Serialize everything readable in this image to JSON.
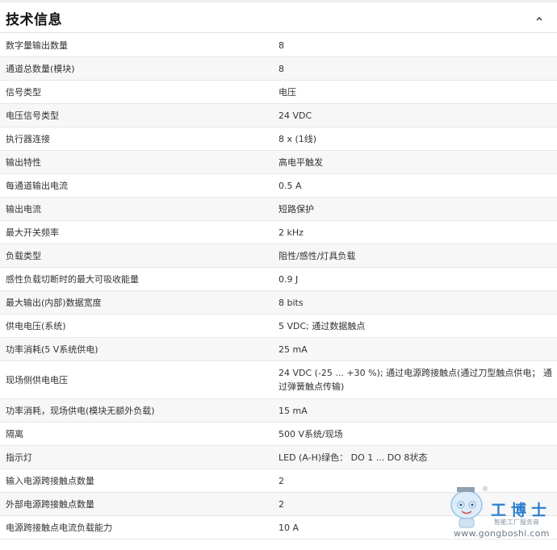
{
  "section": {
    "title": "技术信息"
  },
  "rows": [
    {
      "key": "数字量输出数量",
      "value": "8"
    },
    {
      "key": "通道总数量(模块)",
      "value": "8"
    },
    {
      "key": "信号类型",
      "value": "电压"
    },
    {
      "key": "电压信号类型",
      "value": "24 VDC"
    },
    {
      "key": "执行器连接",
      "value": "8 x (1线)"
    },
    {
      "key": "输出特性",
      "value": "高电平触发"
    },
    {
      "key": "每通道输出电流",
      "value": "0.5 A"
    },
    {
      "key": "输出电流",
      "value": "短路保护"
    },
    {
      "key": "最大开关频率",
      "value": "2 kHz"
    },
    {
      "key": "负载类型",
      "value": "阻性/感性/灯具负载"
    },
    {
      "key": "感性负载切断时的最大可吸收能量",
      "value": "0.9 J"
    },
    {
      "key": "最大输出(内部)数据宽度",
      "value": "8 bits"
    },
    {
      "key": "供电电压(系统)",
      "value": "5 VDC; 通过数据触点"
    },
    {
      "key": "功率消耗(5 V系统供电)",
      "value": "25 mA"
    },
    {
      "key": "现场侧供电电压",
      "value": "24 VDC (-25 ... +30 %); 通过电源跨接触点(通过刀型触点供电； 通过弹簧触点传输)"
    },
    {
      "key": "功率消耗，现场供电(模块无额外负载)",
      "value": "15 mA"
    },
    {
      "key": "隔离",
      "value": "500 V系统/现场"
    },
    {
      "key": "指示灯",
      "value": "LED (A-H)绿色： DO 1 ... DO 8状态"
    },
    {
      "key": "输入电源跨接触点数量",
      "value": "2"
    },
    {
      "key": "外部电源跨接触点数量",
      "value": "2"
    },
    {
      "key": "电源跨接触点电流负载能力",
      "value": "10 A"
    }
  ],
  "watermark": {
    "brand": "工博士",
    "registered": "®",
    "slogan": "智能工厂服务商",
    "url": "www.gongboshi.com"
  },
  "icons": {
    "collapse": "chevron-up-icon",
    "mascot": "robot-mascot-icon"
  },
  "colors": {
    "alt_row": "#f7f7f7",
    "divider": "#e6e6e6",
    "brand_blue": "#2a7fd0"
  }
}
